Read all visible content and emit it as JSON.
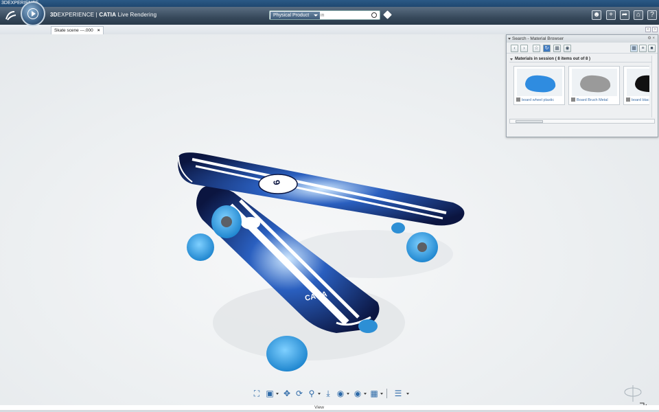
{
  "window": {
    "os_title": "3DEXPERIENCE"
  },
  "header": {
    "brand_text": "3DEXPERIENCE | CATIA Live Rendering",
    "brand_bold": "3D",
    "brand_prefix": "EXPERIENCE | ",
    "brand_catia": "CATIA",
    "brand_suffix": " Live Rendering",
    "search_scope": "Physical Product",
    "search_placeholder": "in",
    "buttons": [
      "user-icon",
      "add-icon",
      "share-icon",
      "home-icon",
      "help-icon"
    ]
  },
  "tabs": [
    {
      "label": "Skate scene ---.000",
      "close": "×"
    }
  ],
  "material_browser": {
    "title": "Search - Material Browser",
    "section_title": "Materials in session ( 8 items out of 8 )",
    "materials": [
      {
        "name": "board wheel plastic",
        "color": "#2f8ce0"
      },
      {
        "name": "Board Bruch Metal",
        "color": "#9a9a9a"
      },
      {
        "name": "board blac",
        "color": "#111111"
      }
    ]
  },
  "bottom_bar": {
    "section_label": "View",
    "page_dots": 3,
    "active_dot": 1
  },
  "colors": {
    "accent_blue": "#2e6aa8",
    "wheel_blue": "#35a6e8",
    "header_dark": "#37495b"
  }
}
